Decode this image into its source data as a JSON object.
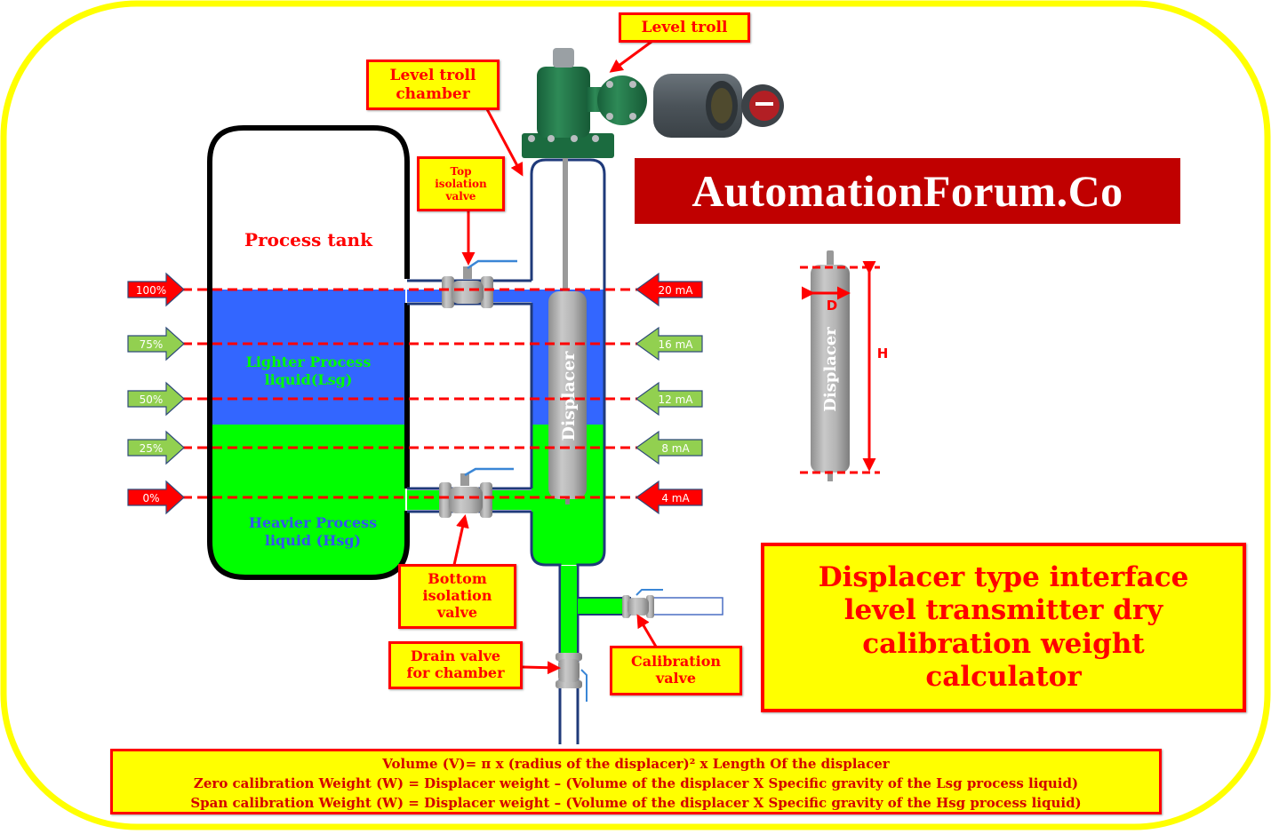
{
  "brand": "AutomationForum.Co",
  "title_lines": [
    "Displacer type interface",
    "level transmitter dry",
    "calibration weight",
    "calculator"
  ],
  "tank": {
    "label": "Process tank",
    "lighter_liquid": [
      "Lighter Process",
      "liquid(Lsg)"
    ],
    "heavier_liquid": [
      "Heavier Process",
      "liquid (Hsg)"
    ]
  },
  "callouts": {
    "level_troll": [
      "Level troll"
    ],
    "level_troll_chamber": [
      "Level troll",
      "chamber"
    ],
    "top_isolation_valve": [
      "Top",
      "isolation",
      "valve"
    ],
    "bottom_isolation_valve": [
      "Bottom",
      "isolation",
      "valve"
    ],
    "drain_valve": [
      "Drain valve",
      "for chamber"
    ],
    "calibration_valve": [
      "Calibration",
      "valve"
    ]
  },
  "level_markers": [
    {
      "percent": "100%",
      "current": "20 mA",
      "color": "#ff0000"
    },
    {
      "percent": "75%",
      "current": "16 mA",
      "color": "#92d050"
    },
    {
      "percent": "50%",
      "current": "12 mA",
      "color": "#92d050"
    },
    {
      "percent": "25%",
      "current": "8 mA",
      "color": "#92d050"
    },
    {
      "percent": "0%",
      "current": "4 mA",
      "color": "#ff0000"
    }
  ],
  "displacer": {
    "label": "Displacer",
    "diameter_label": "D",
    "height_label": "H"
  },
  "formulas": [
    "Volume (V)= π x  (radius of the displacer)² x Length Of the displacer",
    "Zero calibration Weight (W) = Displacer weight – (Volume of the displacer X Specific gravity of the Lsg process  liquid)",
    "Span calibration Weight (W) = Displacer weight – (Volume of the displacer X Specific gravity of the Hsg process  liquid)"
  ],
  "colors": {
    "frame": "#ffff00",
    "lighter_liquid": "#3366ff",
    "heavier_liquid": "#00ff00",
    "accent_red": "#ff0000",
    "marker_green": "#92d050",
    "brand_bg": "#c00000",
    "pipe_outline": "#1f3a7a"
  }
}
